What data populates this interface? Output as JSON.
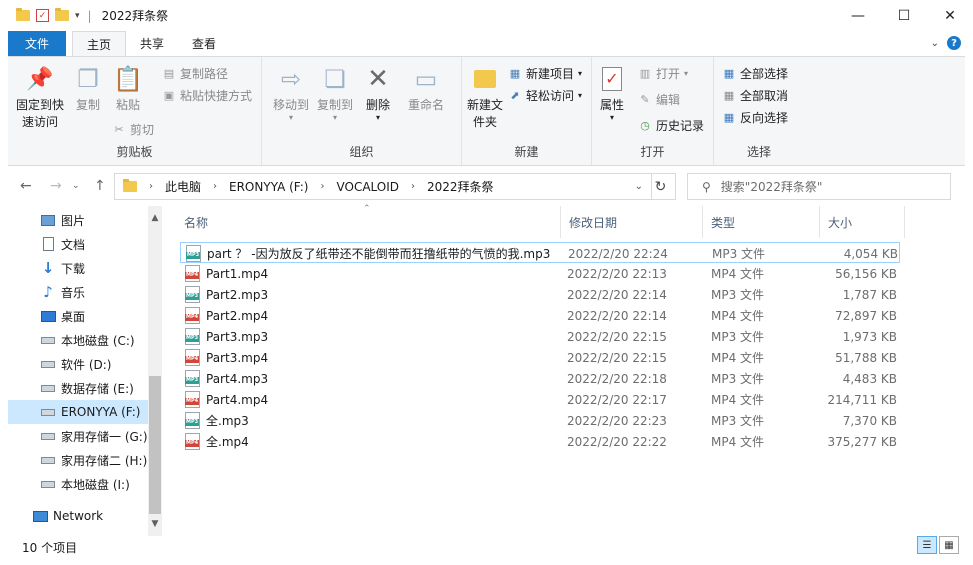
{
  "window": {
    "title": "2022拜条祭",
    "controls": {
      "minimize": "—",
      "maximize": "☐",
      "close": "✕"
    }
  },
  "tabs": [
    {
      "label": "文件"
    },
    {
      "label": "主页"
    },
    {
      "label": "共享"
    },
    {
      "label": "查看"
    }
  ],
  "ribbon": {
    "clipboard": {
      "pin_label": "固定到快速访问",
      "copy_label": "复制",
      "paste_label": "粘贴",
      "copy_path": "复制路径",
      "paste_shortcut": "粘贴快捷方式",
      "cut": "剪切",
      "group_label": "剪贴板"
    },
    "organize": {
      "move_to": "移动到",
      "copy_to": "复制到",
      "delete": "删除",
      "rename": "重命名",
      "group_label": "组织"
    },
    "new": {
      "new_folder": "新建文件夹",
      "new_item": "新建项目",
      "easy_access": "轻松访问",
      "group_label": "新建"
    },
    "open": {
      "properties": "属性",
      "open": "打开",
      "edit": "编辑",
      "history": "历史记录",
      "group_label": "打开"
    },
    "select": {
      "select_all": "全部选择",
      "select_none": "全部取消",
      "invert": "反向选择",
      "group_label": "选择"
    }
  },
  "address": {
    "crumbs": [
      "此电脑",
      "ERONYYA (F:)",
      "VOCALOID",
      "2022拜条祭"
    ],
    "search_placeholder": "搜索\"2022拜条祭\""
  },
  "nav": {
    "items": [
      {
        "label": "图片",
        "icon": "pictures-icon"
      },
      {
        "label": "文档",
        "icon": "documents-icon"
      },
      {
        "label": "下载",
        "icon": "downloads-icon"
      },
      {
        "label": "音乐",
        "icon": "music-icon"
      },
      {
        "label": "桌面",
        "icon": "desktop-icon"
      },
      {
        "label": "本地磁盘 (C:)",
        "icon": "drive-icon"
      },
      {
        "label": "软件 (D:)",
        "icon": "drive-icon"
      },
      {
        "label": "数据存储 (E:)",
        "icon": "drive-icon"
      },
      {
        "label": "ERONYYA (F:)",
        "icon": "usb-drive-icon"
      },
      {
        "label": "家用存储一 (G:)",
        "icon": "drive-icon"
      },
      {
        "label": "家用存储二 (H:)",
        "icon": "drive-icon"
      },
      {
        "label": "本地磁盘 (I:)",
        "icon": "drive-icon"
      },
      {
        "label": "Network",
        "icon": "network-icon"
      }
    ]
  },
  "columns": {
    "name": "名称",
    "date": "修改日期",
    "type": "类型",
    "size": "大小"
  },
  "files": [
    {
      "name": "part ？ -因为放反了纸带还不能倒带而狂撸纸带的气愤的我.mp3",
      "date": "2022/2/20 22:24",
      "type": "MP3 文件",
      "size": "4,054 KB",
      "kind": "mp3"
    },
    {
      "name": "Part1.mp4",
      "date": "2022/2/20 22:13",
      "type": "MP4 文件",
      "size": "56,156 KB",
      "kind": "mp4"
    },
    {
      "name": "Part2.mp3",
      "date": "2022/2/20 22:14",
      "type": "MP3 文件",
      "size": "1,787 KB",
      "kind": "mp3"
    },
    {
      "name": "Part2.mp4",
      "date": "2022/2/20 22:14",
      "type": "MP4 文件",
      "size": "72,897 KB",
      "kind": "mp4"
    },
    {
      "name": "Part3.mp3",
      "date": "2022/2/20 22:15",
      "type": "MP3 文件",
      "size": "1,973 KB",
      "kind": "mp3"
    },
    {
      "name": "Part3.mp4",
      "date": "2022/2/20 22:15",
      "type": "MP4 文件",
      "size": "51,788 KB",
      "kind": "mp4"
    },
    {
      "name": "Part4.mp3",
      "date": "2022/2/20 22:18",
      "type": "MP3 文件",
      "size": "4,483 KB",
      "kind": "mp3"
    },
    {
      "name": "Part4.mp4",
      "date": "2022/2/20 22:17",
      "type": "MP4 文件",
      "size": "214,711 KB",
      "kind": "mp4"
    },
    {
      "name": "全.mp3",
      "date": "2022/2/20 22:23",
      "type": "MP3 文件",
      "size": "7,370 KB",
      "kind": "mp3"
    },
    {
      "name": "全.mp4",
      "date": "2022/2/20 22:22",
      "type": "MP4 文件",
      "size": "375,277 KB",
      "kind": "mp4"
    }
  ],
  "status": {
    "count": "10 个项目"
  }
}
